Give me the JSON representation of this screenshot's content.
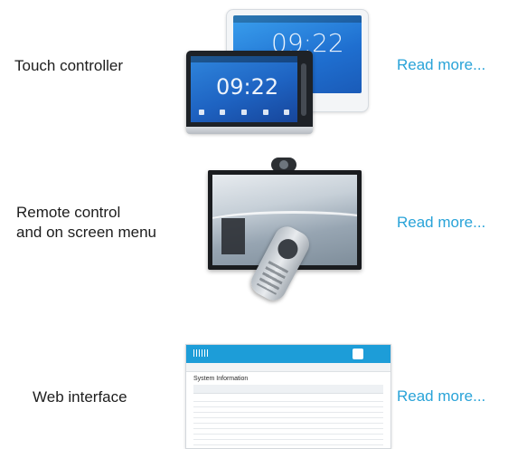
{
  "rows": [
    {
      "label": "Touch controller",
      "link": "Read more...",
      "clock": "09:22",
      "clock_back": "09:22"
    },
    {
      "label": "Remote control\nand on screen menu",
      "link": "Read more..."
    },
    {
      "label": "Web interface",
      "link": "Read more...",
      "page_title": "System Information"
    }
  ],
  "colors": {
    "link": "#29a3d8",
    "text": "#1d1d1d",
    "web_header": "#1d9dd8"
  }
}
